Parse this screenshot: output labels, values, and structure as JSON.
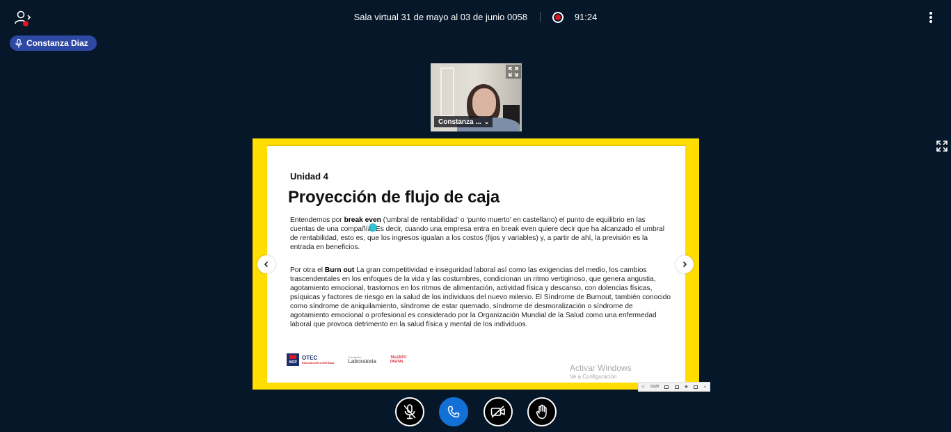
{
  "header": {
    "room_title": "Sala virtual 31 de mayo al 03 de junio 0058",
    "recording_time": "91:24"
  },
  "talker": {
    "name": "Constanza Diaz"
  },
  "webcam": {
    "name_label": "Constanza ..."
  },
  "slide": {
    "unit": "Unidad 4",
    "title": "Proyección de flujo de caja",
    "p1_before": "Entendemos por ",
    "p1_bold": "break even",
    "p1_after": " (‘umbral de rentabilidad’ o ‘punto muerto’ en castellano) el punto de equilibrio en las cuentas de una compañía. Es decir, cuando una empresa entra en break even quiere decir que ha alcanzado el umbral de rentabilidad, esto es, que los ingresos igualan a los costos (fijos y variables) y, a partir de ahí, la previsión es la entrada en beneficios.",
    "p2_before": "Por otra el ",
    "p2_bold": "Burn out",
    "p2_after": " La gran competitividad e inseguridad laboral así como las exigencias del medio, los cambios trascendentales en los enfoques de la vida y las costumbres, condicionan un ritmo vertiginoso, que genera angustia, agotamiento emocional, trastornos en los ritmos de alimentación, actividad física y descanso, con dolencias físicas, psíquicas y factores de riesgo en la salud de los individuos del nuevo milenio. El Síndrome de Burnout, también conocido como síndrome de aniquilamiento, síndrome de estar quemado, síndrome de desmoralización o síndrome de agotamiento emocional o profesional es considerado por la Organización Mundial de la Salud como una enfermedad laboral que provoca detrimento en la salud física y mental de los individuos.",
    "logos": {
      "aiep": "AIEP",
      "otec": "OTEC",
      "otec_sub": "EDUCACIÓN CONTINUA",
      "lab_pre": "Fundación",
      "lab": "Laboratoria",
      "talento_1": "TALENTO",
      "talento_2": "DIGITAL"
    },
    "watermark_title": "Activar Windows",
    "watermark_sub": "Ve a Configuración",
    "toolbar_page": "15/28"
  },
  "colors": {
    "background": "#06172a",
    "presentation_border": "#ffdd00",
    "leave_button": "#1370d6",
    "talker_pill": "#2e49a3",
    "record_dot": "#e0151f"
  },
  "icons": {
    "users": "users-icon",
    "options": "kebab-icon",
    "microphone": "microphone-icon",
    "expand": "expand-icon",
    "previous": "chevron-left-icon",
    "next": "chevron-right-icon",
    "mute": "microphone-off-icon",
    "leave": "phone-icon",
    "camera": "video-off-icon",
    "raise_hand": "hand-icon"
  }
}
